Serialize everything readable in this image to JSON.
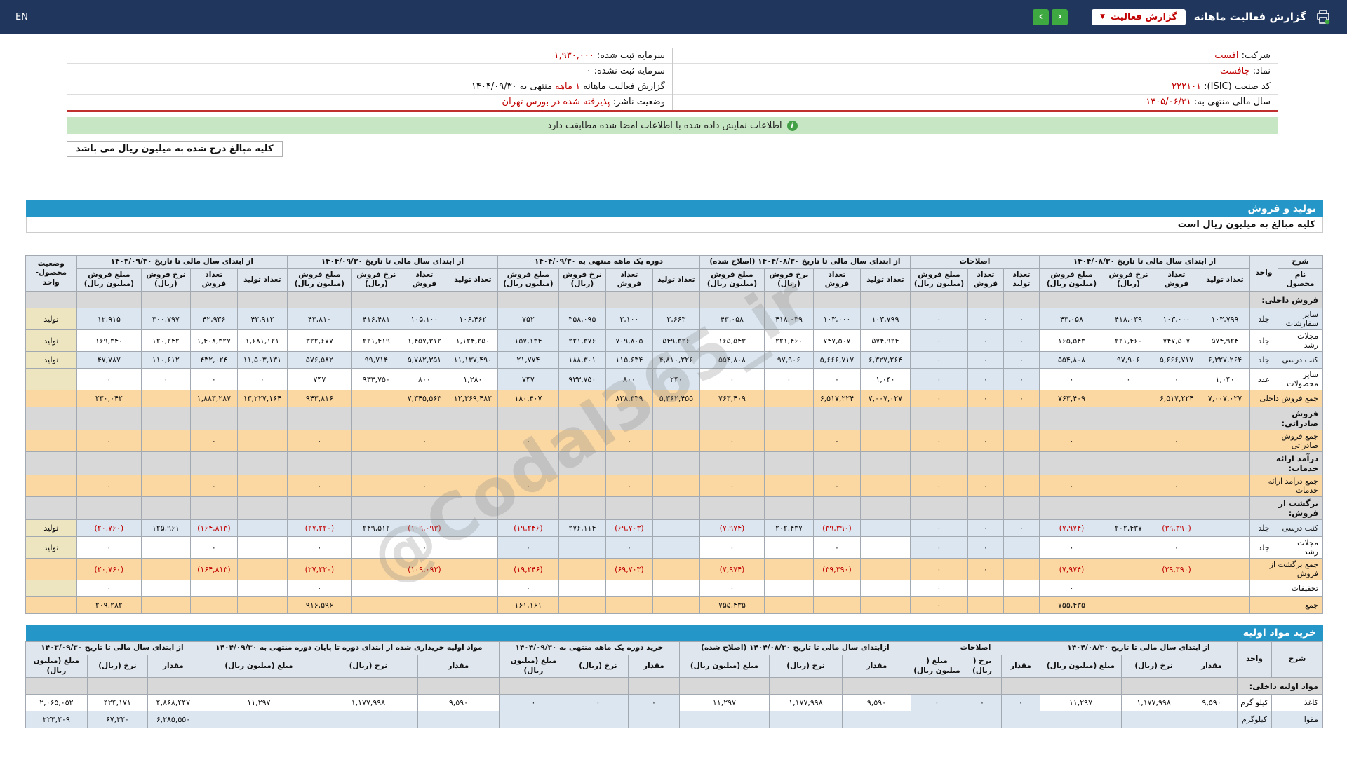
{
  "colors": {
    "topbar_bg": "#20365c",
    "green_button": "#3da940",
    "value_red": "#c00000",
    "banner_bg": "#c7e6c3",
    "banner_icon": "#43a047",
    "section_bar": "#2496c7",
    "row_alt": "#dce6f1",
    "sum_row": "#fbd7a1",
    "status_cell": "#ede5c0",
    "section_row": "#d8d8d8",
    "negative": "#c00000",
    "info_divider_red": "#c0302e"
  },
  "topbar": {
    "lang": "EN",
    "nav_left": "‹",
    "nav_right": "›",
    "report_select": "گزارش فعالیت",
    "title": "گزارش فعالیت ماهانه",
    "caret": "▼"
  },
  "info": {
    "right_rows": [
      {
        "label": "شرکت:",
        "value": "افست",
        "red": true
      },
      {
        "label": "نماد:",
        "value": "چافست",
        "red": true
      },
      {
        "label": "کد صنعت (ISIC):",
        "value": "۲۲۲۱۰۱",
        "red": true
      },
      {
        "label": "سال مالی منتهی به:",
        "value": "۱۴۰۵/۰۶/۳۱",
        "red": true
      }
    ],
    "left_rows": [
      {
        "label": "سرمایه ثبت شده:",
        "value": "۱,۹۳۰,۰۰۰",
        "red": true
      },
      {
        "label": "سرمایه ثبت نشده:",
        "value": "۰",
        "red": false
      },
      {
        "label": "گزارش فعالیت ماهانه",
        "value": "۱ ماهه",
        "red": true,
        "suffix": "منتهی به ۱۴۰۴/۰۹/۳۰"
      },
      {
        "label": "وضعیت ناشر:",
        "value": "پذیرفته شده در بورس تهران",
        "red": true
      }
    ]
  },
  "banner": {
    "icon_glyph": "i",
    "text": "اطلاعات نمایش داده شده با اطلاعات امضا شده مطابقت دارد"
  },
  "note_box": "کلیه مبالغ درج شده به میلیون ریال می باشد",
  "watermark": "@Codal365_ir",
  "sales": {
    "section_title": "تولید و فروش",
    "subtitle": "کلیه مبالغ به میلیون ریال است",
    "header": {
      "desc_top": "شرح",
      "desc_bottom": "نام محصول",
      "unit": "واحد",
      "status": "وضعیت محصول-واحد",
      "groups": [
        {
          "label": "از ابتدای سال مالی تا تاریخ ۱۴۰۴/۰۸/۳۰",
          "subs": [
            "تعداد تولید",
            "تعداد فروش",
            "نرخ فروش (ریال)",
            "مبلغ فروش (میلیون ریال)"
          ]
        },
        {
          "label": "اصلاحات",
          "subs": [
            "تعداد تولید",
            "تعداد فروش",
            "مبلغ فروش (میلیون ریال)"
          ]
        },
        {
          "label": "از ابتدای سال مالی تا تاریخ ۱۴۰۴/۰۸/۳۰ (اصلاح شده)",
          "subs": [
            "تعداد تولید",
            "تعداد فروش",
            "نرخ فروش (ریال)",
            "مبلغ فروش (میلیون ریال)"
          ]
        },
        {
          "label": "دوره یک ماهه منتهی به ۱۴۰۴/۰۹/۳۰",
          "subs": [
            "تعداد تولید",
            "تعداد فروش",
            "نرخ فروش (ریال)",
            "مبلغ فروش (میلیون ریال)"
          ]
        },
        {
          "label": "از ابتدای سال مالی تا تاریخ ۱۴۰۴/۰۹/۳۰",
          "subs": [
            "تعداد تولید",
            "تعداد فروش",
            "نرخ فروش (ریال)",
            "مبلغ فروش (میلیون ریال)"
          ]
        },
        {
          "label": "از ابتدای سال مالی تا تاریخ ۱۴۰۳/۰۹/۳۰",
          "subs": [
            "تعداد تولید",
            "تعداد فروش",
            "نرخ فروش (ریال)",
            "مبلغ فروش (میلیون ریال)"
          ]
        }
      ]
    },
    "rows": [
      {
        "type": "section",
        "label": "فروش داخلی:"
      },
      {
        "type": "data",
        "alt": true,
        "name": "سایر سفارشات",
        "unit": "جلد",
        "status": "تولید",
        "cells": [
          "۱۰۳,۷۹۹",
          "۱۰۳,۰۰۰",
          "۴۱۸,۰۳۹",
          "۴۳,۰۵۸",
          "۰",
          "۰",
          "۰",
          "۱۰۳,۷۹۹",
          "۱۰۳,۰۰۰",
          "۴۱۸,۰۳۹",
          "۴۳,۰۵۸",
          "۲,۶۶۳",
          "۲,۱۰۰",
          "۳۵۸,۰۹۵",
          "۷۵۲",
          "۱۰۶,۴۶۲",
          "۱۰۵,۱۰۰",
          "۴۱۶,۴۸۱",
          "۴۳,۸۱۰",
          "۴۲,۹۱۲",
          "۴۲,۹۳۶",
          "۳۰۰,۷۹۷",
          "۱۲,۹۱۵"
        ]
      },
      {
        "type": "data",
        "name": "مجلات رشد",
        "unit": "جلد",
        "status": "تولید",
        "cells": [
          "۵۷۴,۹۲۴",
          "۷۴۷,۵۰۷",
          "۲۲۱,۴۶۰",
          "۱۶۵,۵۴۳",
          "۰",
          "۰",
          "۰",
          "۵۷۴,۹۲۴",
          "۷۴۷,۵۰۷",
          "۲۲۱,۴۶۰",
          "۱۶۵,۵۴۳",
          "۵۴۹,۳۲۶",
          "۷۰۹,۸۰۵",
          "۲۲۱,۳۷۶",
          "۱۵۷,۱۳۴",
          "۱,۱۲۴,۲۵۰",
          "۱,۴۵۷,۳۱۲",
          "۲۲۱,۴۱۹",
          "۳۲۲,۶۷۷",
          "۱,۶۸۱,۱۲۱",
          "۱,۴۰۸,۳۲۷",
          "۱۲۰,۲۴۲",
          "۱۶۹,۳۴۰"
        ]
      },
      {
        "type": "data",
        "alt": true,
        "name": "کتب درسی",
        "unit": "جلد",
        "status": "تولید",
        "cells": [
          "۶,۳۲۷,۲۶۴",
          "۵,۶۶۶,۷۱۷",
          "۹۷,۹۰۶",
          "۵۵۴,۸۰۸",
          "۰",
          "۰",
          "۰",
          "۶,۳۲۷,۲۶۴",
          "۵,۶۶۶,۷۱۷",
          "۹۷,۹۰۶",
          "۵۵۴,۸۰۸",
          "۴,۸۱۰,۲۲۶",
          "۱۱۵,۶۳۴",
          "۱۸۸,۳۰۱",
          "۲۱,۷۷۴",
          "۱۱,۱۳۷,۴۹۰",
          "۵,۷۸۲,۳۵۱",
          "۹۹,۷۱۴",
          "۵۷۶,۵۸۲",
          "۱۱,۵۰۳,۱۳۱",
          "۴۳۲,۰۲۴",
          "۱۱۰,۶۱۲",
          "۴۷,۷۸۷"
        ]
      },
      {
        "type": "data",
        "name": "سایر محصولات",
        "unit": "عدد",
        "status": "",
        "cells": [
          "۱,۰۴۰",
          "۰",
          "۰",
          "۰",
          "۰",
          "۰",
          "۰",
          "۱,۰۴۰",
          "۰",
          "۰",
          "۰",
          "۲۴۰",
          "۸۰۰",
          "۹۳۳,۷۵۰",
          "۷۴۷",
          "۱,۲۸۰",
          "۸۰۰",
          "۹۳۳,۷۵۰",
          "۷۴۷",
          "۰",
          "۰",
          "۰",
          "۰"
        ]
      },
      {
        "type": "sum",
        "name": "جمع فروش داخلی",
        "cells": [
          "۷,۰۰۷,۰۲۷",
          "۶,۵۱۷,۲۲۴",
          "",
          "۷۶۳,۴۰۹",
          "۰",
          "۰",
          "۰",
          "۷,۰۰۷,۰۲۷",
          "۶,۵۱۷,۲۲۴",
          "",
          "۷۶۳,۴۰۹",
          "۵,۳۶۲,۴۵۵",
          "۸۲۸,۳۳۹",
          "",
          "۱۸۰,۴۰۷",
          "۱۲,۳۶۹,۴۸۲",
          "۷,۳۴۵,۵۶۳",
          "",
          "۹۴۳,۸۱۶",
          "۱۳,۲۲۷,۱۶۴",
          "۱,۸۸۳,۲۸۷",
          "",
          "۲۳۰,۰۴۲"
        ]
      },
      {
        "type": "section",
        "label": "فروش صادراتی:"
      },
      {
        "type": "sum",
        "name": "جمع فروش صادراتی",
        "cells": [
          "",
          "۰",
          "",
          "۰",
          "",
          "۰",
          "۰",
          "",
          "۰",
          "",
          "۰",
          "",
          "۰",
          "",
          "۰",
          "",
          "۰",
          "",
          "۰",
          "",
          "۰",
          "",
          "۰"
        ]
      },
      {
        "type": "section",
        "label": "درآمد ارائه خدمات:"
      },
      {
        "type": "sum",
        "name": "جمع درآمد ارائه خدمات",
        "cells": [
          "",
          "۰",
          "",
          "۰",
          "",
          "۰",
          "۰",
          "",
          "۰",
          "",
          "۰",
          "",
          "۰",
          "",
          "۰",
          "",
          "۰",
          "",
          "۰",
          "",
          "۰",
          "",
          "۰"
        ]
      },
      {
        "type": "section",
        "label": "برگشت از فروش:"
      },
      {
        "type": "data",
        "alt": true,
        "name": "کتب درسی",
        "unit": "جلد",
        "status": "تولید",
        "cells": [
          "",
          "(۳۹,۳۹۰)",
          "۲۰۲,۴۳۷",
          "(۷,۹۷۴)",
          "۰",
          "۰",
          "۰",
          "",
          "(۳۹,۳۹۰)",
          "۲۰۲,۴۳۷",
          "(۷,۹۷۴)",
          "",
          "(۶۹,۷۰۳)",
          "۲۷۶,۱۱۴",
          "(۱۹,۲۴۶)",
          "",
          "(۱۰۹,۰۹۳)",
          "۲۴۹,۵۱۲",
          "(۲۷,۲۲۰)",
          "",
          "(۱۶۴,۸۱۳)",
          "۱۲۵,۹۶۱",
          "(۲۰,۷۶۰)"
        ]
      },
      {
        "type": "data",
        "name": "مجلات رشد",
        "unit": "جلد",
        "status": "تولید",
        "cells": [
          "",
          "۰",
          "",
          "۰",
          "",
          "۰",
          "۰",
          "",
          "۰",
          "",
          "۰",
          "",
          "۰",
          "",
          "۰",
          "",
          "۰",
          "",
          "۰",
          "",
          "۰",
          "",
          "۰"
        ]
      },
      {
        "type": "sum",
        "name": "جمع برگشت از فروش",
        "cells": [
          "",
          "(۳۹,۳۹۰)",
          "",
          "(۷,۹۷۴)",
          "",
          "۰",
          "۰",
          "",
          "(۳۹,۳۹۰)",
          "",
          "(۷,۹۷۴)",
          "",
          "(۶۹,۷۰۳)",
          "",
          "(۱۹,۲۴۶)",
          "",
          "(۱۰۹,۰۹۳)",
          "",
          "(۲۷,۲۲۰)",
          "",
          "(۱۶۴,۸۱۳)",
          "",
          "(۲۰,۷۶۰)"
        ]
      },
      {
        "type": "plain",
        "name": "تخفیفات",
        "cells": [
          "",
          "",
          "",
          "۰",
          "",
          "",
          "۰",
          "",
          "",
          "",
          "۰",
          "",
          "",
          "",
          "۰",
          "",
          "",
          "",
          "۰",
          "",
          "",
          "",
          "۰"
        ]
      },
      {
        "type": "sum",
        "name": "جمع",
        "cells": [
          "",
          "",
          "",
          "۷۵۵,۴۳۵",
          "",
          "",
          "۰",
          "",
          "",
          "",
          "۷۵۵,۴۳۵",
          "",
          "",
          "",
          "۱۶۱,۱۶۱",
          "",
          "",
          "",
          "۹۱۶,۵۹۶",
          "",
          "",
          "",
          "۲۰۹,۲۸۲"
        ]
      }
    ]
  },
  "purchase": {
    "section_title": "خرید مواد اولیه",
    "header": {
      "desc_top": "شرح",
      "unit": "واحد",
      "groups": [
        {
          "label": "از ابتدای سال مالی تا تاریخ ۱۴۰۴/۰۸/۳۰",
          "subs": [
            "مقدار",
            "نرخ (ریال)",
            "مبلغ (میلیون ریال)"
          ]
        },
        {
          "label": "اصلاحات",
          "subs": [
            "مقدار",
            "نرخ ( ریال)",
            "مبلغ ( میلیون ریال)"
          ]
        },
        {
          "label": "ازابتدای سال مالی تا تاریخ ۱۴۰۴/۰۸/۳۰ (اصلاح شده)",
          "subs": [
            "مقدار",
            "نرخ (ریال)",
            "مبلغ (میلیون ریال)"
          ]
        },
        {
          "label": "خرید دوره یک ماهه منتهی به ۱۴۰۴/۰۹/۳۰",
          "subs": [
            "مقدار",
            "نرخ (ریال)",
            "مبلغ (میلیون ریال)"
          ]
        },
        {
          "label": "مواد اولیه خریداری شده از ابتدای دوره تا پایان دوره منتهی به ۱۴۰۴/۰۹/۳۰",
          "subs": [
            "مقدار",
            "نرخ (ریال)",
            "مبلغ (میلیون ریال)"
          ]
        },
        {
          "label": "از ابتدای سال مالی تا تاریخ ۱۴۰۳/۰۹/۳۰",
          "subs": [
            "مقدار",
            "نرخ (ریال)",
            "مبلغ (میلیون ریال)"
          ]
        }
      ]
    },
    "rows": [
      {
        "type": "section",
        "label": "مواد اولیه داخلی:"
      },
      {
        "type": "data",
        "name": "کاغذ",
        "unit": "کیلو گرم",
        "cells": [
          "۹,۵۹۰",
          "۱,۱۷۷,۹۹۸",
          "۱۱,۲۹۷",
          "۰",
          "۰",
          "۰",
          "۹,۵۹۰",
          "۱,۱۷۷,۹۹۸",
          "۱۱,۲۹۷",
          "۰",
          "۰",
          "۰",
          "۹,۵۹۰",
          "۱,۱۷۷,۹۹۸",
          "۱۱,۲۹۷",
          "۴,۸۶۸,۴۴۷",
          "۴۲۴,۱۷۱",
          "۲,۰۶۵,۰۵۲"
        ]
      },
      {
        "type": "data",
        "alt": true,
        "name": "مقوا",
        "unit": "کیلوگرم",
        "cells": [
          "",
          "",
          "",
          "",
          "",
          "",
          "",
          "",
          "",
          "",
          "",
          "",
          "",
          "",
          "",
          "۶,۲۸۵,۵۵۰",
          "۶۷,۳۲۰",
          "۲۲۳,۲۰۹"
        ]
      }
    ]
  }
}
